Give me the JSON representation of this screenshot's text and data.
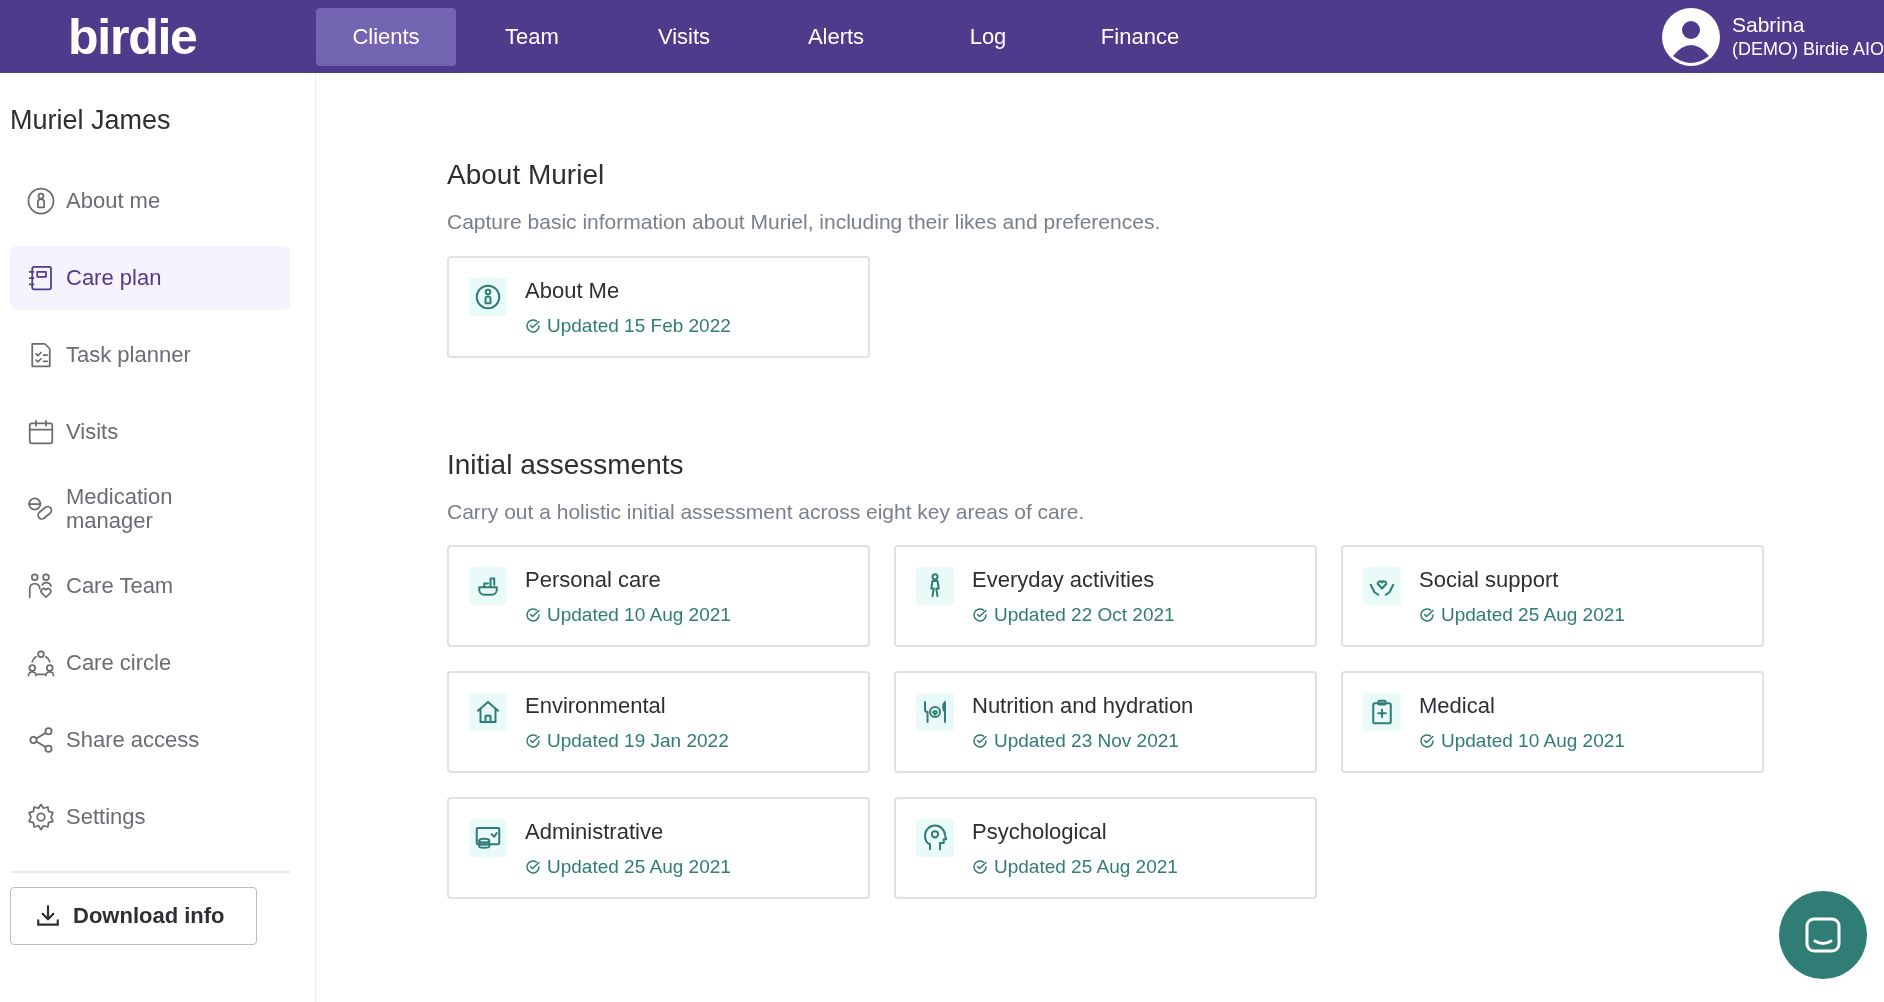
{
  "header": {
    "logo": "birdie",
    "nav": [
      {
        "label": "Clients",
        "selected": true
      },
      {
        "label": "Team",
        "selected": false
      },
      {
        "label": "Visits",
        "selected": false
      },
      {
        "label": "Alerts",
        "selected": false
      },
      {
        "label": "Log",
        "selected": false
      },
      {
        "label": "Finance",
        "selected": false
      }
    ],
    "user": {
      "name": "Sabrina",
      "org": "(DEMO) Birdie AIO"
    }
  },
  "sidebar": {
    "title": "Muriel James",
    "items": [
      {
        "label": "About me",
        "selected": false
      },
      {
        "label": "Care plan",
        "selected": true
      },
      {
        "label": "Task planner",
        "selected": false
      },
      {
        "label": "Visits",
        "selected": false
      },
      {
        "label": "Medication manager",
        "selected": false
      },
      {
        "label": "Care Team",
        "selected": false
      },
      {
        "label": "Care circle",
        "selected": false
      },
      {
        "label": "Share access",
        "selected": false
      },
      {
        "label": "Settings",
        "selected": false
      }
    ],
    "download_button": "Download info"
  },
  "sections": [
    {
      "title": "About Muriel",
      "description": "Capture basic information about Muriel, including their likes and preferences.",
      "cards": [
        {
          "title": "About Me",
          "updated": "Updated 15 Feb 2022"
        }
      ]
    },
    {
      "title": "Initial assessments",
      "description": "Carry out a holistic initial assessment across eight key areas of care.",
      "cards": [
        {
          "title": "Personal care",
          "updated": "Updated 10 Aug 2021"
        },
        {
          "title": "Everyday activities",
          "updated": "Updated 22 Oct 2021"
        },
        {
          "title": "Social support",
          "updated": "Updated 25 Aug 2021"
        },
        {
          "title": "Environmental",
          "updated": "Updated 19 Jan 2022"
        },
        {
          "title": "Nutrition and hydration",
          "updated": "Updated 23 Nov 2021"
        },
        {
          "title": "Medical",
          "updated": "Updated 10 Aug 2021"
        },
        {
          "title": "Administrative",
          "updated": "Updated 25 Aug 2021"
        },
        {
          "title": "Psychological",
          "updated": "Updated 25 Aug 2021"
        }
      ]
    }
  ]
}
